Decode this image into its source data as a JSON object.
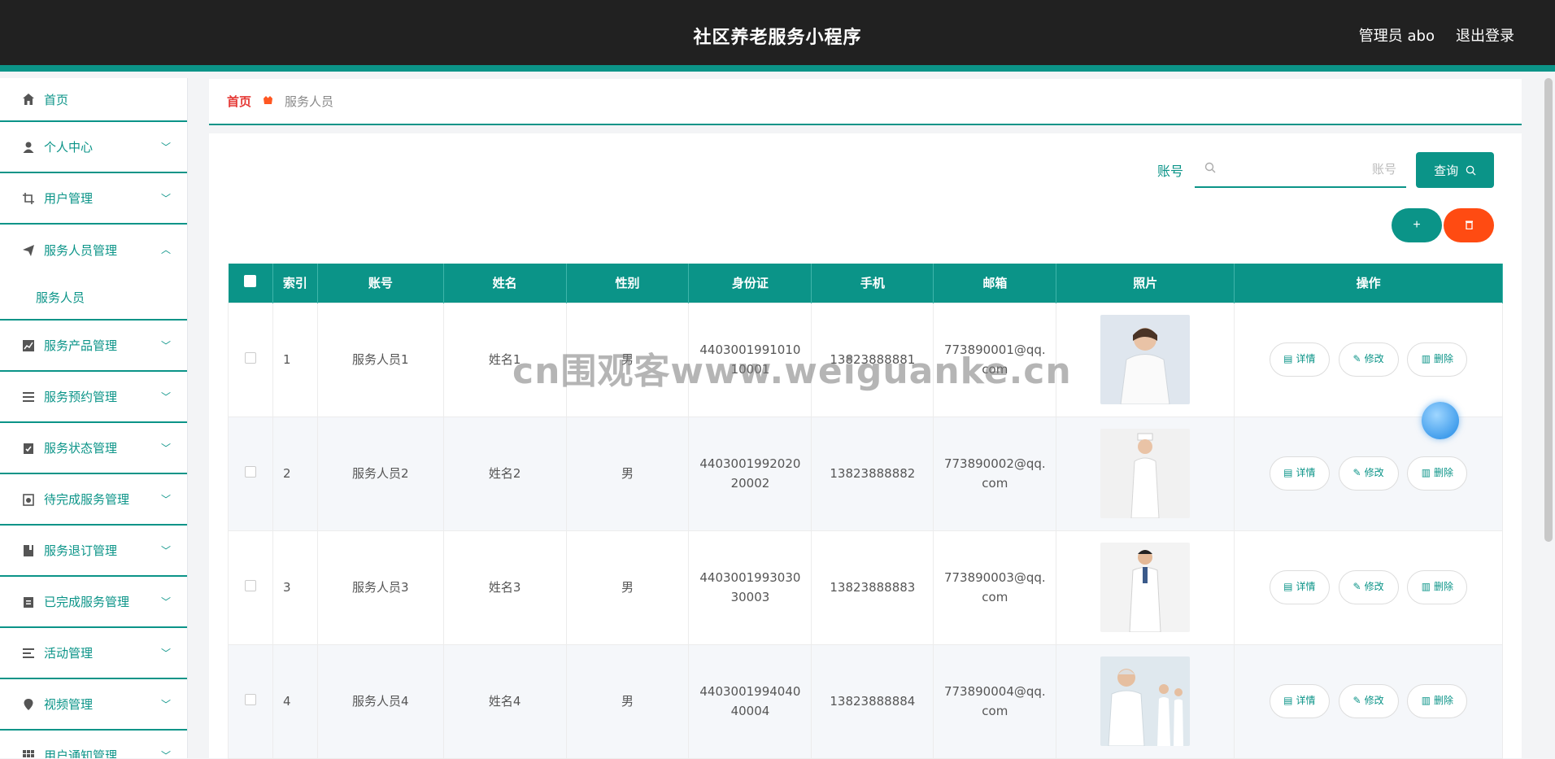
{
  "header": {
    "title": "社区养老服务小程序",
    "admin": "管理员 abo",
    "logout": "退出登录"
  },
  "sidebar": {
    "items": [
      {
        "label": "首页",
        "icon": "home-icon"
      },
      {
        "label": "个人中心",
        "icon": "user-icon"
      },
      {
        "label": "用户管理",
        "icon": "crop-icon"
      },
      {
        "label": "服务人员管理",
        "icon": "send-icon",
        "expanded": true,
        "sub": "服务人员"
      },
      {
        "label": "服务产品管理",
        "icon": "chart-icon"
      },
      {
        "label": "服务预约管理",
        "icon": "list-icon"
      },
      {
        "label": "服务状态管理",
        "icon": "clipboard-check-icon"
      },
      {
        "label": "待完成服务管理",
        "icon": "clipboard-clock-icon"
      },
      {
        "label": "服务退订管理",
        "icon": "book-icon"
      },
      {
        "label": "已完成服务管理",
        "icon": "clipboard-icon"
      },
      {
        "label": "活动管理",
        "icon": "menu-icon"
      },
      {
        "label": "视频管理",
        "icon": "location-icon"
      },
      {
        "label": "用户通知管理",
        "icon": "grid-icon"
      }
    ]
  },
  "breadcrumb": {
    "home": "首页",
    "current": "服务人员"
  },
  "search": {
    "label": "账号",
    "placeholder": "账号",
    "button": "查询"
  },
  "actions": {
    "add": "+",
    "delete_icon": "trash-icon"
  },
  "table": {
    "headers": [
      "索引",
      "账号",
      "姓名",
      "性别",
      "身份证",
      "手机",
      "邮箱",
      "照片",
      "操作"
    ],
    "rows": [
      {
        "index": "1",
        "account": "服务人员1",
        "name": "姓名1",
        "gender": "男",
        "id_card": "440300199101010001",
        "phone": "13823888881",
        "email": "773890001@qq.com"
      },
      {
        "index": "2",
        "account": "服务人员2",
        "name": "姓名2",
        "gender": "男",
        "id_card": "440300199202020002",
        "phone": "13823888882",
        "email": "773890002@qq.com"
      },
      {
        "index": "3",
        "account": "服务人员3",
        "name": "姓名3",
        "gender": "男",
        "id_card": "440300199303030003",
        "phone": "13823888883",
        "email": "773890003@qq.com"
      },
      {
        "index": "4",
        "account": "服务人员4",
        "name": "姓名4",
        "gender": "男",
        "id_card": "440300199404040004",
        "phone": "13823888884",
        "email": "773890004@qq.com"
      }
    ],
    "ops": {
      "detail": "详情",
      "edit": "修改",
      "delete": "删除"
    }
  },
  "watermark": "cn围观客www.weiguanke.cn",
  "colors": {
    "accent": "#0b9488",
    "danger": "#ff4b12",
    "header_bg": "#212121"
  }
}
